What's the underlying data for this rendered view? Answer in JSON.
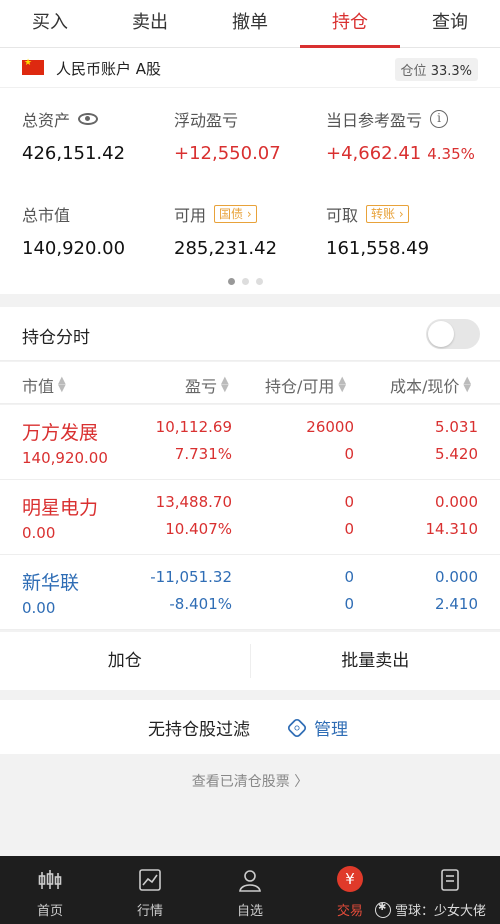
{
  "tabs": [
    "买入",
    "卖出",
    "撤单",
    "持仓",
    "查询"
  ],
  "active_tab": "持仓",
  "account": {
    "name": "人民币账户 A股",
    "position_label": "仓位",
    "position_value": "33.3%"
  },
  "summary": {
    "total_assets_label": "总资产",
    "total_assets": "426,151.42",
    "floating_pl_label": "浮动盈亏",
    "floating_pl": "+12,550.07",
    "daily_pl_label": "当日参考盈亏",
    "daily_pl": "+4,662.41",
    "daily_pl_pct": "4.35%",
    "market_value_label": "总市值",
    "market_value": "140,920.00",
    "available_label": "可用",
    "available_tag": "国债",
    "available": "285,231.42",
    "withdrawable_label": "可取",
    "withdrawable_tag": "转账",
    "withdrawable": "161,558.49"
  },
  "toggle": {
    "label": "持仓分时",
    "on": false
  },
  "table": {
    "headers": [
      "市值",
      "盈亏",
      "持仓/可用",
      "成本/现价"
    ],
    "rows": [
      {
        "name": "万方发展",
        "market_value": "140,920.00",
        "pl": "10,112.69",
        "pl_pct": "7.731%",
        "position": "26000",
        "available": "0",
        "cost": "5.031",
        "price": "5.420",
        "tone": "red"
      },
      {
        "name": "明星电力",
        "market_value": "0.00",
        "pl": "13,488.70",
        "pl_pct": "10.407%",
        "position": "0",
        "available": "0",
        "cost": "0.000",
        "price": "14.310",
        "tone": "red"
      },
      {
        "name": "新华联",
        "market_value": "0.00",
        "pl": "-11,051.32",
        "pl_pct": "-8.401%",
        "position": "0",
        "available": "0",
        "cost": "0.000",
        "price": "2.410",
        "tone": "blue"
      }
    ]
  },
  "actions": {
    "add": "加仓",
    "batch_sell": "批量卖出"
  },
  "filter": {
    "label": "无持仓股过滤",
    "manage": "管理"
  },
  "cleared_link": "查看已清仓股票 〉",
  "bottom_nav": [
    {
      "label": "首页",
      "icon": "candlestick-icon"
    },
    {
      "label": "行情",
      "icon": "chart-icon"
    },
    {
      "label": "自选",
      "icon": "user-icon"
    },
    {
      "label": "交易",
      "icon": "yuan-icon",
      "active": true
    },
    {
      "label": "",
      "icon": "document-icon"
    }
  ],
  "watermark": "雪球：少女大佬",
  "colors": {
    "accent_red": "#d93030",
    "blue": "#2f6db5",
    "tag_orange": "#e8a23a"
  }
}
